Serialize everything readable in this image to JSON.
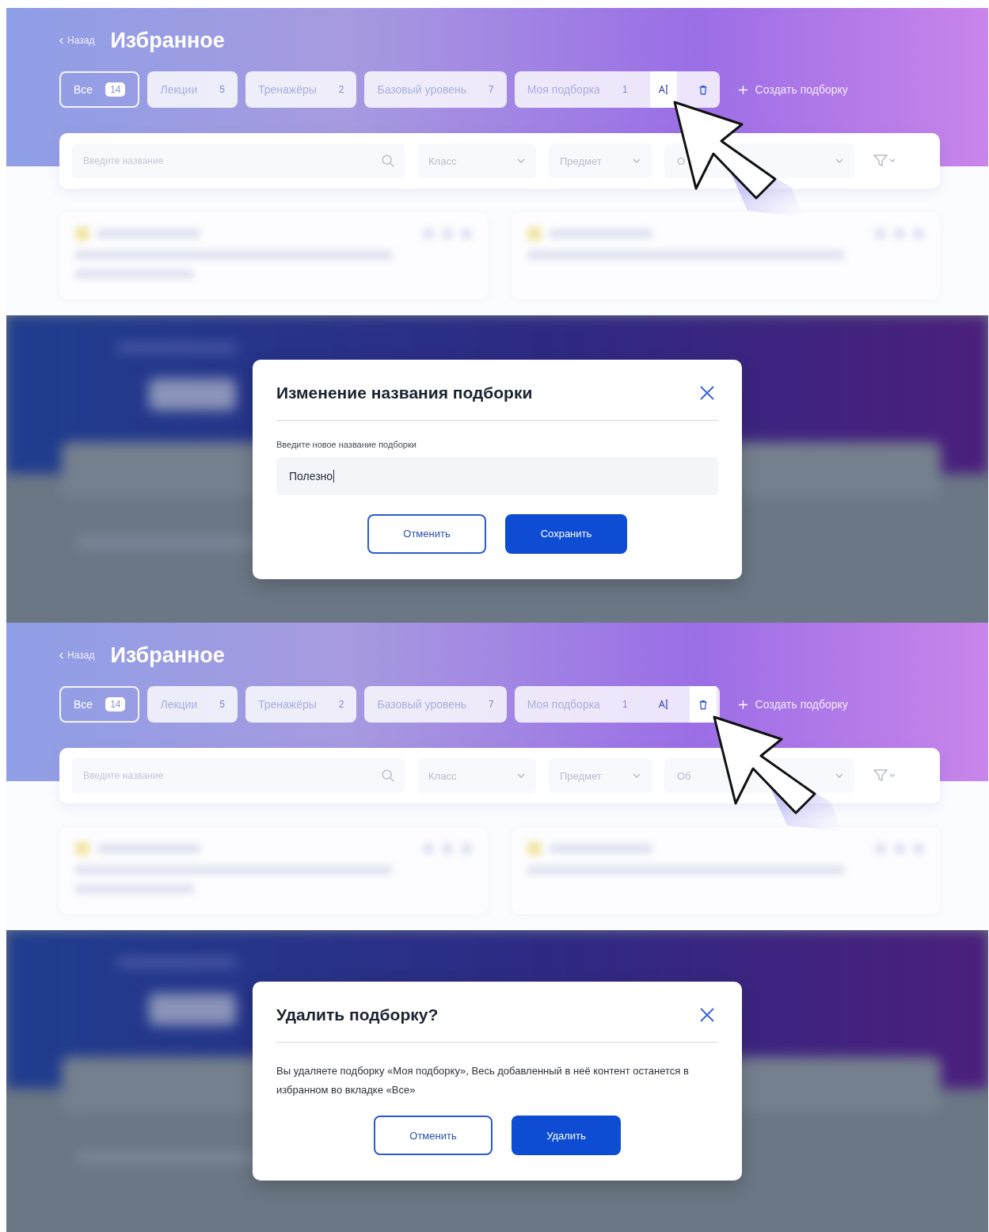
{
  "panels": [
    {
      "kind": "page",
      "back": "Назад",
      "title": "Избранное",
      "tabs": [
        {
          "label": "Все",
          "count": "14",
          "selected": true
        },
        {
          "label": "Лекции",
          "count": "5",
          "selected": false
        },
        {
          "label": "Тренажёры",
          "count": "2",
          "selected": false
        },
        {
          "label": "Базовый уровень",
          "count": "7",
          "selected": false
        },
        {
          "label": "Моя подборка",
          "count": "1",
          "selected": false,
          "actions": [
            {
              "kind": "rename",
              "hovered": true
            },
            {
              "kind": "delete",
              "hovered": false
            }
          ]
        }
      ],
      "create": "Создать подборку",
      "search": {
        "placeholder": "Введите название"
      },
      "filters": [
        "Класс",
        "Предмет",
        "О"
      ]
    },
    {
      "kind": "dialog",
      "dialog": {
        "kind": "rename",
        "title": "Изменение названия подборки",
        "label": "Введите новое название подборки",
        "value": "Полезно",
        "focused": true,
        "buttons": [
          {
            "label": "Отменить",
            "primary": false
          },
          {
            "label": "Сохранить",
            "primary": true
          }
        ]
      }
    },
    {
      "kind": "page",
      "back": "Назад",
      "title": "Избранное",
      "tabs": [
        {
          "label": "Все",
          "count": "14",
          "selected": true
        },
        {
          "label": "Лекции",
          "count": "5",
          "selected": false
        },
        {
          "label": "Тренажёры",
          "count": "2",
          "selected": false
        },
        {
          "label": "Базовый уровень",
          "count": "7",
          "selected": false
        },
        {
          "label": "Моя подборка",
          "count": "1",
          "selected": false,
          "actions": [
            {
              "kind": "rename",
              "hovered": false
            },
            {
              "kind": "delete",
              "hovered": true
            }
          ]
        }
      ],
      "create": "Создать подборку",
      "search": {
        "placeholder": "Введите название"
      },
      "filters": [
        "Класс",
        "Предмет",
        "Об"
      ]
    },
    {
      "kind": "dialog",
      "dialog": {
        "kind": "delete",
        "title": "Удалить подборку?",
        "text": "Вы удаляете подборку «Моя подборку», Весь добавленный в неё контент останется в избранном во вкладке «Все»",
        "buttons": [
          {
            "label": "Отменить",
            "primary": false
          },
          {
            "label": "Удалить",
            "primary": true
          }
        ]
      }
    }
  ]
}
